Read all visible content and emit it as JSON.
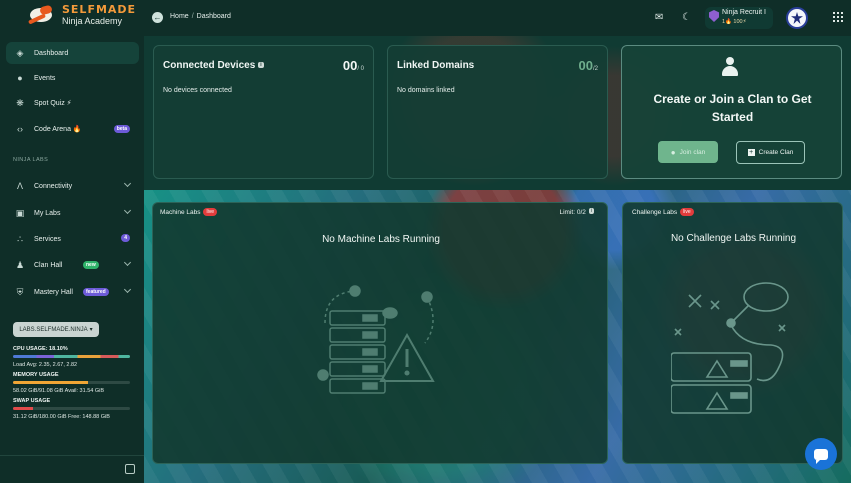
{
  "brand": {
    "title": "SELFMADE",
    "subtitle": "Ninja Academy"
  },
  "breadcrumb": {
    "home": "Home",
    "separator": "/",
    "current": "Dashboard"
  },
  "user": {
    "name": "Ninja Recruit I",
    "meta": "1🔥 100⚡"
  },
  "sidebar": {
    "items": [
      {
        "label": "Dashboard",
        "icon": "dashboard-icon"
      },
      {
        "label": "Events",
        "icon": "events-icon"
      },
      {
        "label": "Spot Quiz ⚡",
        "icon": "quiz-icon"
      },
      {
        "label": "Code Arena 🔥",
        "icon": "code-icon",
        "badge": "beta"
      }
    ],
    "section_label": "NINJA LABS",
    "lab_items": [
      {
        "label": "Connectivity",
        "icon": "connectivity-icon"
      },
      {
        "label": "My Labs",
        "icon": "labs-icon"
      },
      {
        "label": "Services",
        "icon": "services-icon",
        "badge": "4"
      },
      {
        "label": "Clan Hall",
        "icon": "clan-icon",
        "badge": "new"
      },
      {
        "label": "Mastery Hall",
        "icon": "mastery-icon",
        "badge": "featured"
      }
    ],
    "server": "LABS.SELFMADE.NINJA",
    "cpu": {
      "title": "CPU USAGE: 18.10%",
      "load": "Load Avg: 2.35, 2.67, 2.82",
      "percent": 18.1
    },
    "memory": {
      "title": "MEMORY USAGE",
      "detail": "58.02 GiB/91.08 GiB Avail: 31.54 GiB",
      "percent": 63.7
    },
    "swap": {
      "title": "SWAP USAGE",
      "detail": "31.12 GiB/180.00 GiB Free: 148.88 GiB",
      "percent": 17.3
    }
  },
  "devices": {
    "title": "Connected Devices",
    "badge": "i",
    "count": "00",
    "total": "/ 0",
    "empty": "No devices connected"
  },
  "domains": {
    "title": "Linked Domains",
    "count": "00",
    "total": "/2",
    "empty": "No domains linked"
  },
  "clan": {
    "title": "Create or Join a Clan to Get Started",
    "join": "Join clan",
    "create": "Create Clan"
  },
  "machine_labs": {
    "title": "Machine Labs",
    "live": "live",
    "limit": "Limit: 0/2",
    "limit_badge": "i",
    "empty": "No Machine Labs Running"
  },
  "challenge_labs": {
    "title": "Challenge Labs",
    "live": "live",
    "empty": "No Challenge Labs Running"
  },
  "colors": {
    "accent": "#15433a",
    "cpu_bar": "#4f7ad6",
    "memory_bar": "#f0a535",
    "swap_bar": "#e24b4b",
    "chat": "#1a73d8"
  }
}
